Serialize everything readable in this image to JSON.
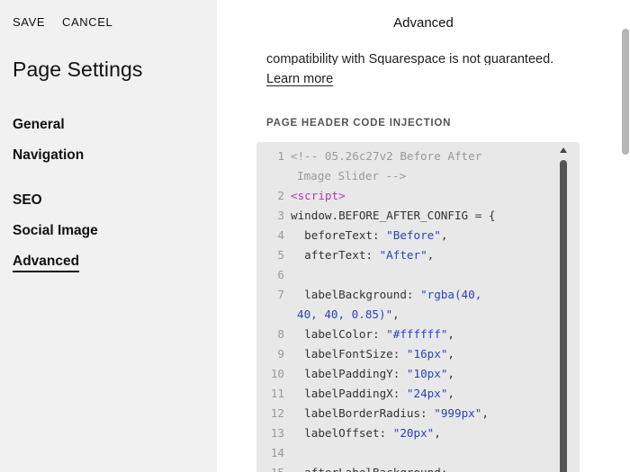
{
  "toolbar": {
    "save_label": "SAVE",
    "cancel_label": "CANCEL"
  },
  "sidebar": {
    "title": "Page Settings",
    "items": [
      {
        "label": "General"
      },
      {
        "label": "Navigation"
      },
      {
        "label": "SEO"
      },
      {
        "label": "Social Image"
      },
      {
        "label": "Advanced",
        "active": true
      }
    ]
  },
  "panel": {
    "title": "Advanced",
    "description_tail": "compatibility with Squarespace is not guaranteed.",
    "learn_more": "Learn more",
    "section_label": "PAGE HEADER CODE INJECTION"
  },
  "code": {
    "lines": [
      {
        "n": "1",
        "parts": [
          {
            "t": "<!-- 05.26c27v2 Before After",
            "c": "comment"
          }
        ],
        "cont": [
          {
            "t": "Image Slider -->",
            "c": "comment"
          }
        ]
      },
      {
        "n": "2",
        "parts": [
          {
            "t": "<script>",
            "c": "tag"
          }
        ]
      },
      {
        "n": "3",
        "parts": [
          {
            "t": "window.BEFORE_AFTER_CONFIG = {",
            "c": "plain"
          }
        ]
      },
      {
        "n": "4",
        "parts": [
          {
            "t": "  beforeText: ",
            "c": "plain"
          },
          {
            "t": "\"Before\"",
            "c": "str"
          },
          {
            "t": ",",
            "c": "plain"
          }
        ]
      },
      {
        "n": "5",
        "parts": [
          {
            "t": "  afterText: ",
            "c": "plain"
          },
          {
            "t": "\"After\"",
            "c": "str"
          },
          {
            "t": ",",
            "c": "plain"
          }
        ]
      },
      {
        "n": "6",
        "parts": [
          {
            "t": "",
            "c": "plain"
          }
        ]
      },
      {
        "n": "7",
        "parts": [
          {
            "t": "  labelBackground: ",
            "c": "plain"
          },
          {
            "t": "\"rgba(40,",
            "c": "str"
          }
        ],
        "cont": [
          {
            "t": "40, 40, 0.85)\"",
            "c": "str"
          },
          {
            "t": ",",
            "c": "plain"
          }
        ]
      },
      {
        "n": "8",
        "parts": [
          {
            "t": "  labelColor: ",
            "c": "plain"
          },
          {
            "t": "\"#ffffff\"",
            "c": "str"
          },
          {
            "t": ",",
            "c": "plain"
          }
        ]
      },
      {
        "n": "9",
        "parts": [
          {
            "t": "  labelFontSize: ",
            "c": "plain"
          },
          {
            "t": "\"16px\"",
            "c": "str"
          },
          {
            "t": ",",
            "c": "plain"
          }
        ]
      },
      {
        "n": "10",
        "parts": [
          {
            "t": "  labelPaddingY: ",
            "c": "plain"
          },
          {
            "t": "\"10px\"",
            "c": "str"
          },
          {
            "t": ",",
            "c": "plain"
          }
        ]
      },
      {
        "n": "11",
        "parts": [
          {
            "t": "  labelPaddingX: ",
            "c": "plain"
          },
          {
            "t": "\"24px\"",
            "c": "str"
          },
          {
            "t": ",",
            "c": "plain"
          }
        ]
      },
      {
        "n": "12",
        "parts": [
          {
            "t": "  labelBorderRadius: ",
            "c": "plain"
          },
          {
            "t": "\"999px\"",
            "c": "str"
          },
          {
            "t": ",",
            "c": "plain"
          }
        ]
      },
      {
        "n": "13",
        "parts": [
          {
            "t": "  labelOffset: ",
            "c": "plain"
          },
          {
            "t": "\"20px\"",
            "c": "str"
          },
          {
            "t": ",",
            "c": "plain"
          }
        ]
      },
      {
        "n": "14",
        "parts": [
          {
            "t": "",
            "c": "plain"
          }
        ]
      },
      {
        "n": "15",
        "parts": [
          {
            "t": "  afterLabelBackground:",
            "c": "plain"
          }
        ]
      }
    ]
  },
  "colors": {
    "sidebar_bg": "#f1f1f1",
    "code_bg": "#e8e8e8",
    "string": "#2a44b8",
    "tag": "#b03bb0",
    "comment": "#999999"
  }
}
